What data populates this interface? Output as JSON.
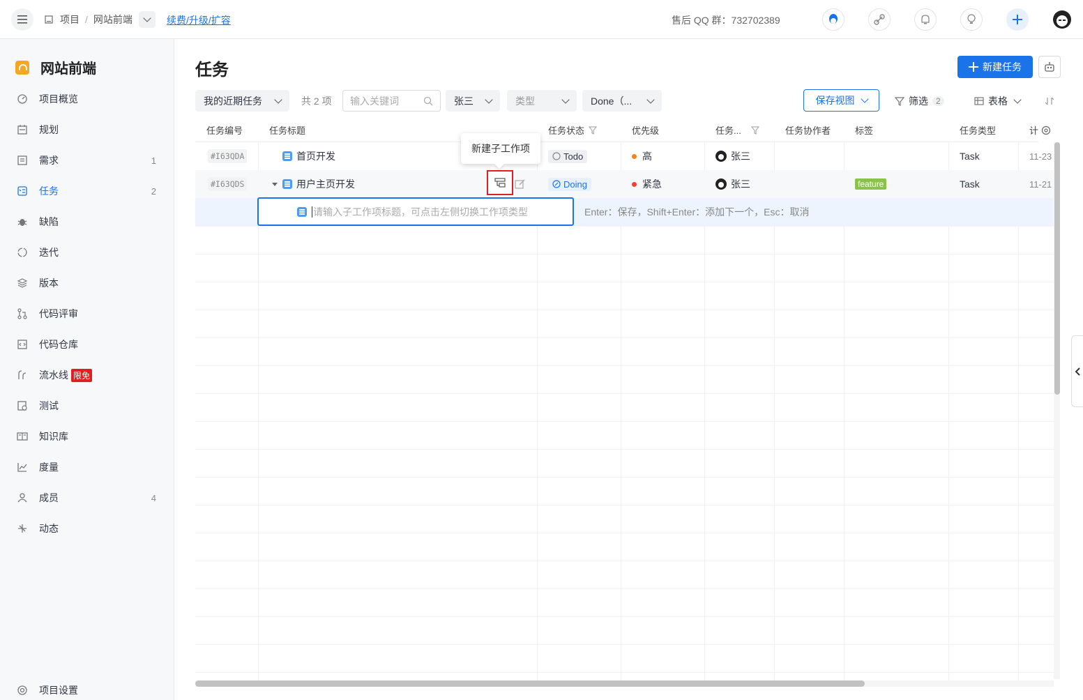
{
  "topbar": {
    "breadcrumb": [
      "项目",
      "/",
      "网站前端"
    ],
    "renew_link": "续费/升级/扩容",
    "qq_group": "售后 QQ 群：732702389"
  },
  "sidebar": {
    "project_name": "网站前端",
    "items": [
      {
        "label": "项目概览",
        "icon": "dashboard-icon",
        "count": ""
      },
      {
        "label": "规划",
        "icon": "calendar-icon",
        "count": ""
      },
      {
        "label": "需求",
        "icon": "document-icon",
        "count": "1"
      },
      {
        "label": "任务",
        "icon": "task-icon",
        "count": "2"
      },
      {
        "label": "缺陷",
        "icon": "bug-icon",
        "count": ""
      },
      {
        "label": "迭代",
        "icon": "cycle-icon",
        "count": ""
      },
      {
        "label": "版本",
        "icon": "layers-icon",
        "count": ""
      },
      {
        "label": "代码评审",
        "icon": "merge-icon",
        "count": ""
      },
      {
        "label": "代码仓库",
        "icon": "code-icon",
        "count": ""
      },
      {
        "label": "流水线",
        "icon": "pipeline-icon",
        "count": "",
        "badge": "限免"
      },
      {
        "label": "测试",
        "icon": "test-icon",
        "count": ""
      },
      {
        "label": "知识库",
        "icon": "book-icon",
        "count": ""
      },
      {
        "label": "度量",
        "icon": "chart-icon",
        "count": ""
      },
      {
        "label": "成员",
        "icon": "user-icon",
        "count": "4"
      },
      {
        "label": "动态",
        "icon": "activity-icon",
        "count": ""
      }
    ],
    "settings_label": "项目设置",
    "active_index": 3
  },
  "main": {
    "title": "任务",
    "new_task_label": "新建任务",
    "filters": {
      "recent": "我的近期任务",
      "total": "共 2 项",
      "search_placeholder": "输入关键词",
      "assignee": "张三",
      "type": "类型",
      "status": "Done（...",
      "save_view": "保存视图",
      "filter_label": "筛选",
      "filter_count": "2",
      "view_label": "表格"
    },
    "columns": [
      "任务编号",
      "任务标题",
      "任务状态",
      "优先级",
      "任务...",
      "任务协作者",
      "标签",
      "任务类型",
      "计"
    ],
    "rows": [
      {
        "id": "#I63QDA",
        "title": "首页开发",
        "status": "Todo",
        "priority": "高",
        "priority_color": "#f5811f",
        "assignee": "张三",
        "tag": "",
        "type": "Task",
        "date": "11-23"
      },
      {
        "id": "#I63QDS",
        "title": "用户主页开发",
        "status": "Doing",
        "priority": "紧急",
        "priority_color": "#f04134",
        "assignee": "张三",
        "tag": "feature",
        "type": "Task",
        "date": "11-21"
      }
    ],
    "tooltip": "新建子工作项",
    "sub_input_placeholder": "请输入子工作项标题，可点击左侧切换工作项类型",
    "sub_hint": "Enter：保存，Shift+Enter：添加下一个，Esc：取消"
  },
  "colors": {
    "accent": "#1a73e8",
    "feature_tag": "#8bc34a",
    "highlight_box": "#e02020"
  }
}
